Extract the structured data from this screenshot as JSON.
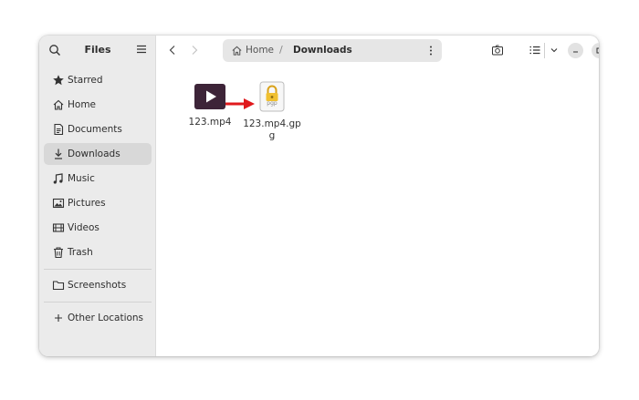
{
  "app": {
    "title": "Files"
  },
  "sidebar": {
    "items": [
      {
        "label": "Starred",
        "icon": "star-icon"
      },
      {
        "label": "Home",
        "icon": "home-icon"
      },
      {
        "label": "Documents",
        "icon": "document-icon"
      },
      {
        "label": "Downloads",
        "icon": "download-icon",
        "active": true
      },
      {
        "label": "Music",
        "icon": "music-icon"
      },
      {
        "label": "Pictures",
        "icon": "picture-icon"
      },
      {
        "label": "Videos",
        "icon": "video-icon"
      },
      {
        "label": "Trash",
        "icon": "trash-icon"
      }
    ],
    "bookmarks": [
      {
        "label": "Screenshots",
        "icon": "folder-icon"
      }
    ],
    "other_locations": {
      "label": "Other Locations",
      "icon": "plus-icon"
    }
  },
  "pathbar": {
    "home": "Home",
    "separator": "/",
    "current": "Downloads"
  },
  "files": [
    {
      "name": "123.mp4",
      "type": "video-file",
      "color": "#3d2438"
    },
    {
      "name": "123.mp4.gp g",
      "type": "pgp-file",
      "badge": "pgp",
      "lock_color": "#f0c030"
    }
  ],
  "annotation": {
    "type": "arrow",
    "color": "#e0191c"
  },
  "colors": {
    "sidebar_bg": "#ebebeb",
    "active_bg": "#d8d8d8",
    "pathbar_bg": "#e6e6e6"
  }
}
